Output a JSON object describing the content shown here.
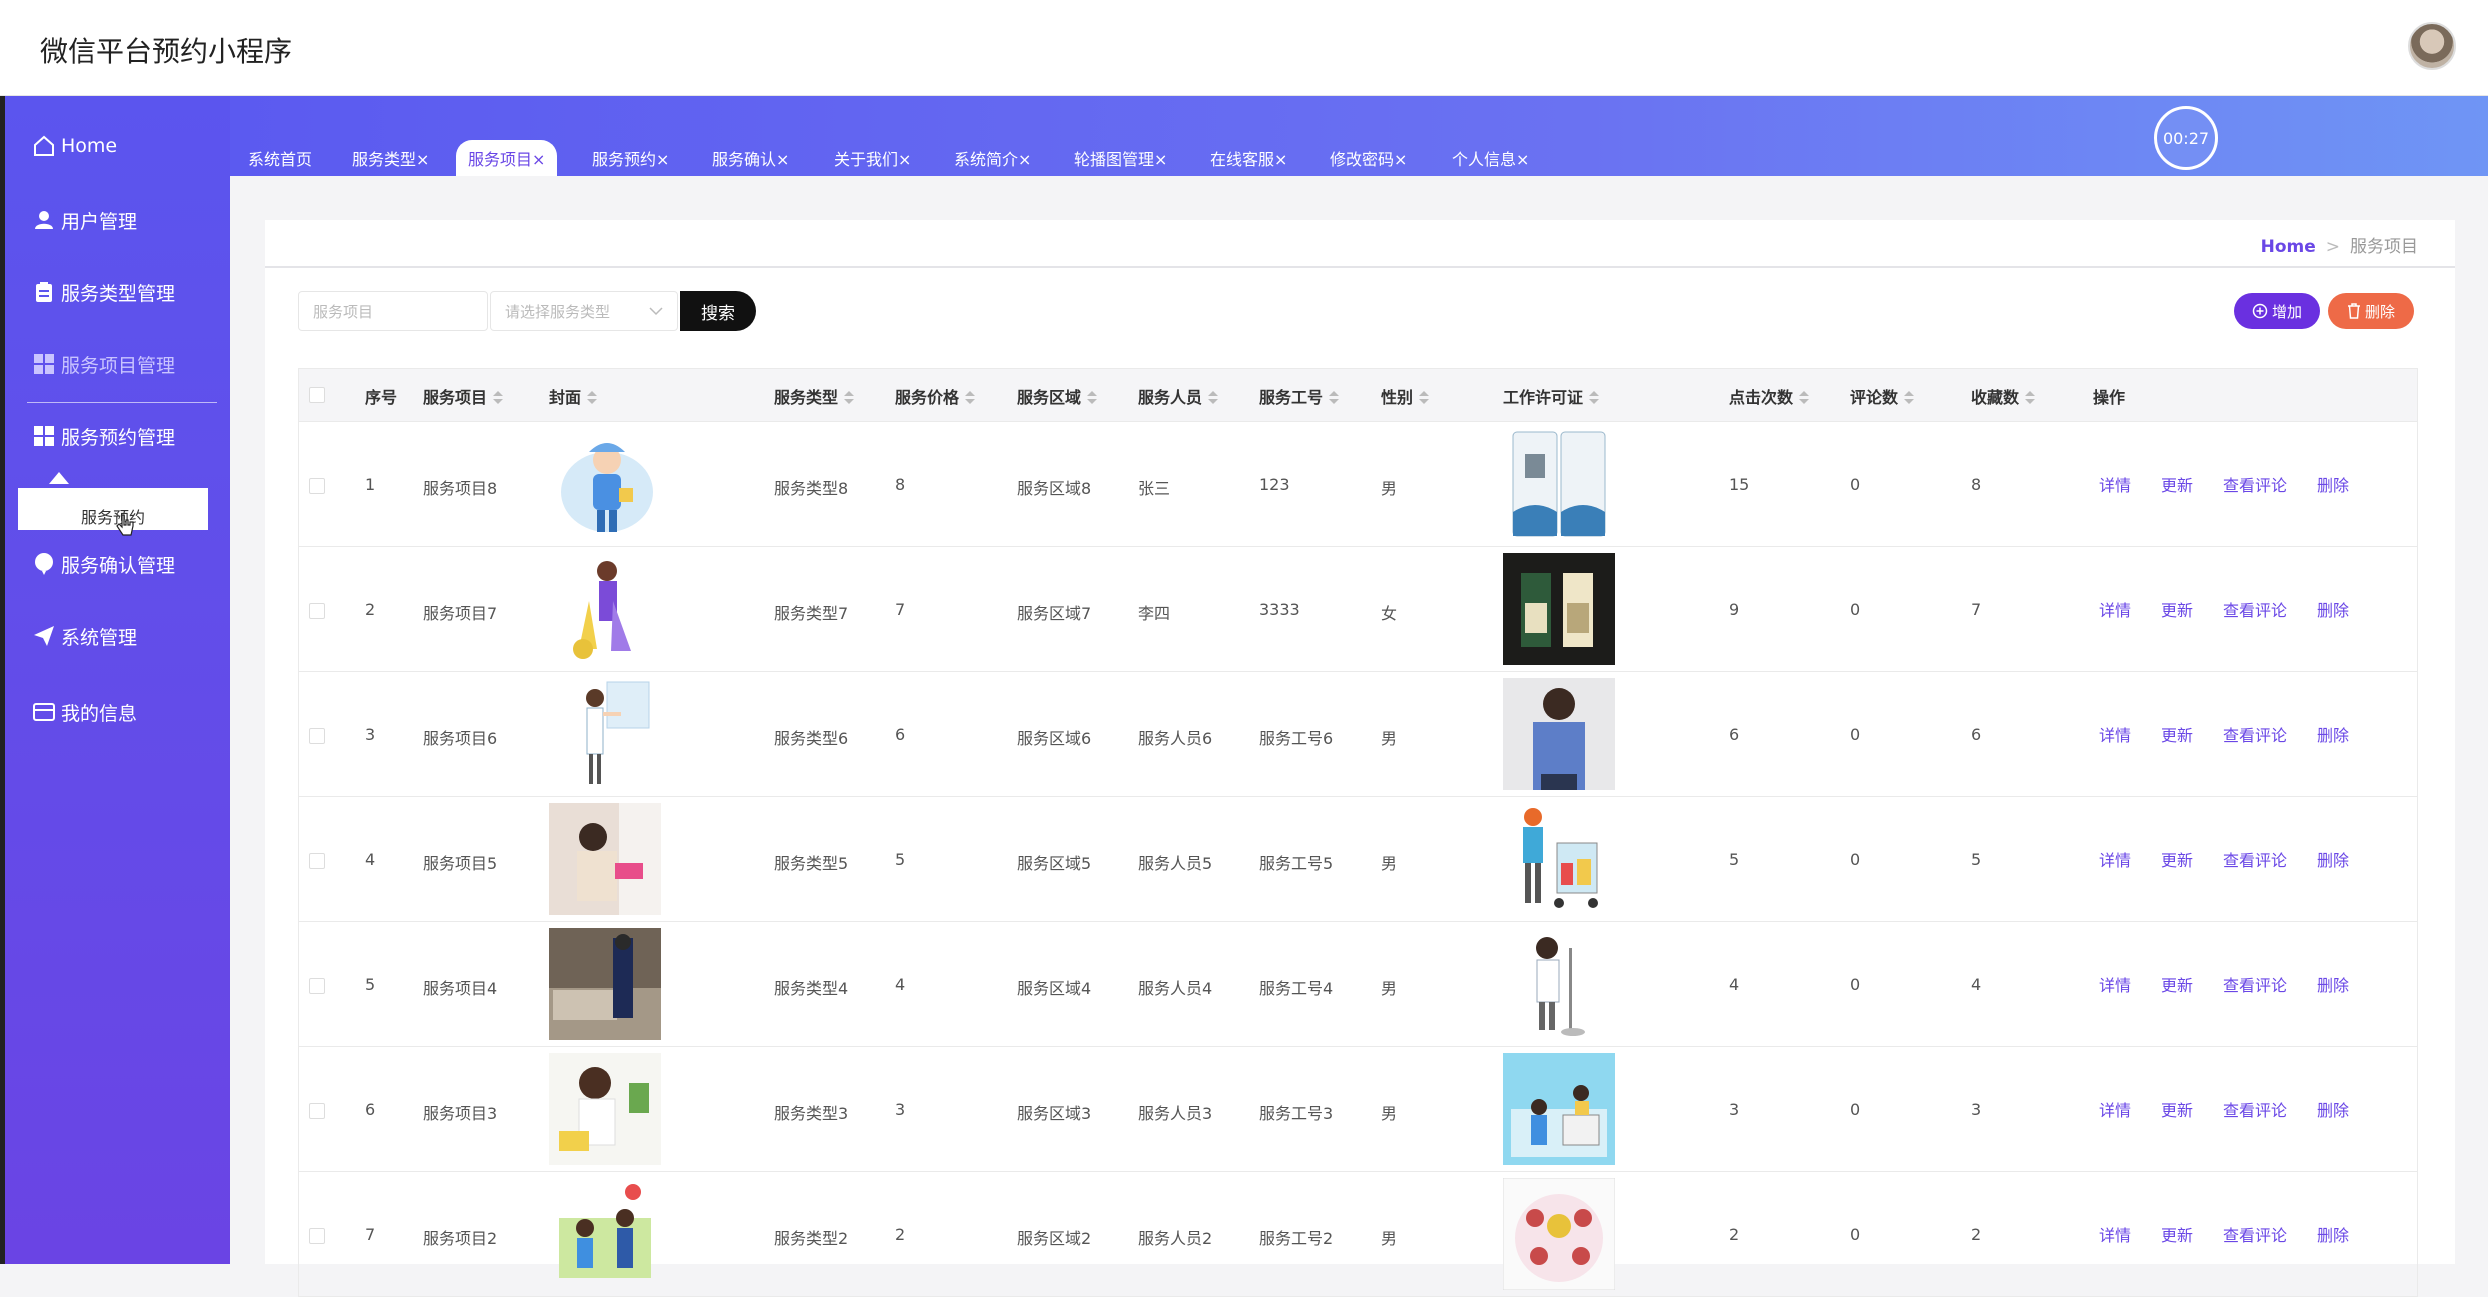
{
  "app": {
    "title": "微信平台预约小程序"
  },
  "timer": "00:27",
  "sidebar": {
    "items": [
      {
        "label": "Home",
        "icon": "home-icon"
      },
      {
        "label": "用户管理",
        "icon": "user-icon"
      },
      {
        "label": "服务类型管理",
        "icon": "clipboard-icon"
      },
      {
        "label": "服务项目管理",
        "icon": "grid-icon"
      },
      {
        "label": "服务预约管理",
        "icon": "grid-icon"
      },
      {
        "label": "服务确认管理",
        "icon": "balloon-icon"
      },
      {
        "label": "系统管理",
        "icon": "paper-plane-icon"
      },
      {
        "label": "我的信息",
        "icon": "card-icon"
      }
    ],
    "submenu_item": "服务预约"
  },
  "tabs": [
    {
      "label": "系统首页"
    },
    {
      "label": "服务类型×"
    },
    {
      "label": "服务项目×"
    },
    {
      "label": "服务预约×"
    },
    {
      "label": "服务确认×"
    },
    {
      "label": "关于我们×"
    },
    {
      "label": "系统简介×"
    },
    {
      "label": "轮播图管理×"
    },
    {
      "label": "在线客服×"
    },
    {
      "label": "修改密码×"
    },
    {
      "label": "个人信息×"
    }
  ],
  "breadcrumb": {
    "home": "Home",
    "sep": ">",
    "current": "服务项目"
  },
  "search": {
    "placeholder": "服务项目",
    "type_placeholder": "请选择服务类型",
    "button": "搜索"
  },
  "actions": {
    "add": "增加",
    "delete": "删除"
  },
  "table": {
    "headers": [
      "序号",
      "服务项目",
      "封面",
      "服务类型",
      "服务价格",
      "服务区域",
      "服务人员",
      "服务工号",
      "性别",
      "工作许可证",
      "点击次数",
      "评论数",
      "收藏数",
      "操作"
    ],
    "row_actions": [
      "详情",
      "更新",
      "查看评论",
      "删除"
    ],
    "rows": [
      {
        "no": "1",
        "name": "服务项目8",
        "type": "服务类型8",
        "price": "8",
        "area": "服务区域8",
        "staff": "张三",
        "code": "123",
        "gender": "男",
        "clicks": "15",
        "comments": "0",
        "favorites": "8"
      },
      {
        "no": "2",
        "name": "服务项目7",
        "type": "服务类型7",
        "price": "7",
        "area": "服务区域7",
        "staff": "李四",
        "code": "3333",
        "gender": "女",
        "clicks": "9",
        "comments": "0",
        "favorites": "7"
      },
      {
        "no": "3",
        "name": "服务项目6",
        "type": "服务类型6",
        "price": "6",
        "area": "服务区域6",
        "staff": "服务人员6",
        "code": "服务工号6",
        "gender": "男",
        "clicks": "6",
        "comments": "0",
        "favorites": "6"
      },
      {
        "no": "4",
        "name": "服务项目5",
        "type": "服务类型5",
        "price": "5",
        "area": "服务区域5",
        "staff": "服务人员5",
        "code": "服务工号5",
        "gender": "男",
        "clicks": "5",
        "comments": "0",
        "favorites": "5"
      },
      {
        "no": "5",
        "name": "服务项目4",
        "type": "服务类型4",
        "price": "4",
        "area": "服务区域4",
        "staff": "服务人员4",
        "code": "服务工号4",
        "gender": "男",
        "clicks": "4",
        "comments": "0",
        "favorites": "4"
      },
      {
        "no": "6",
        "name": "服务项目3",
        "type": "服务类型3",
        "price": "3",
        "area": "服务区域3",
        "staff": "服务人员3",
        "code": "服务工号3",
        "gender": "男",
        "clicks": "3",
        "comments": "0",
        "favorites": "3"
      },
      {
        "no": "7",
        "name": "服务项目2",
        "type": "服务类型2",
        "price": "2",
        "area": "服务区域2",
        "staff": "服务人员2",
        "code": "服务工号2",
        "gender": "男",
        "clicks": "2",
        "comments": "0",
        "favorites": "2"
      }
    ]
  }
}
